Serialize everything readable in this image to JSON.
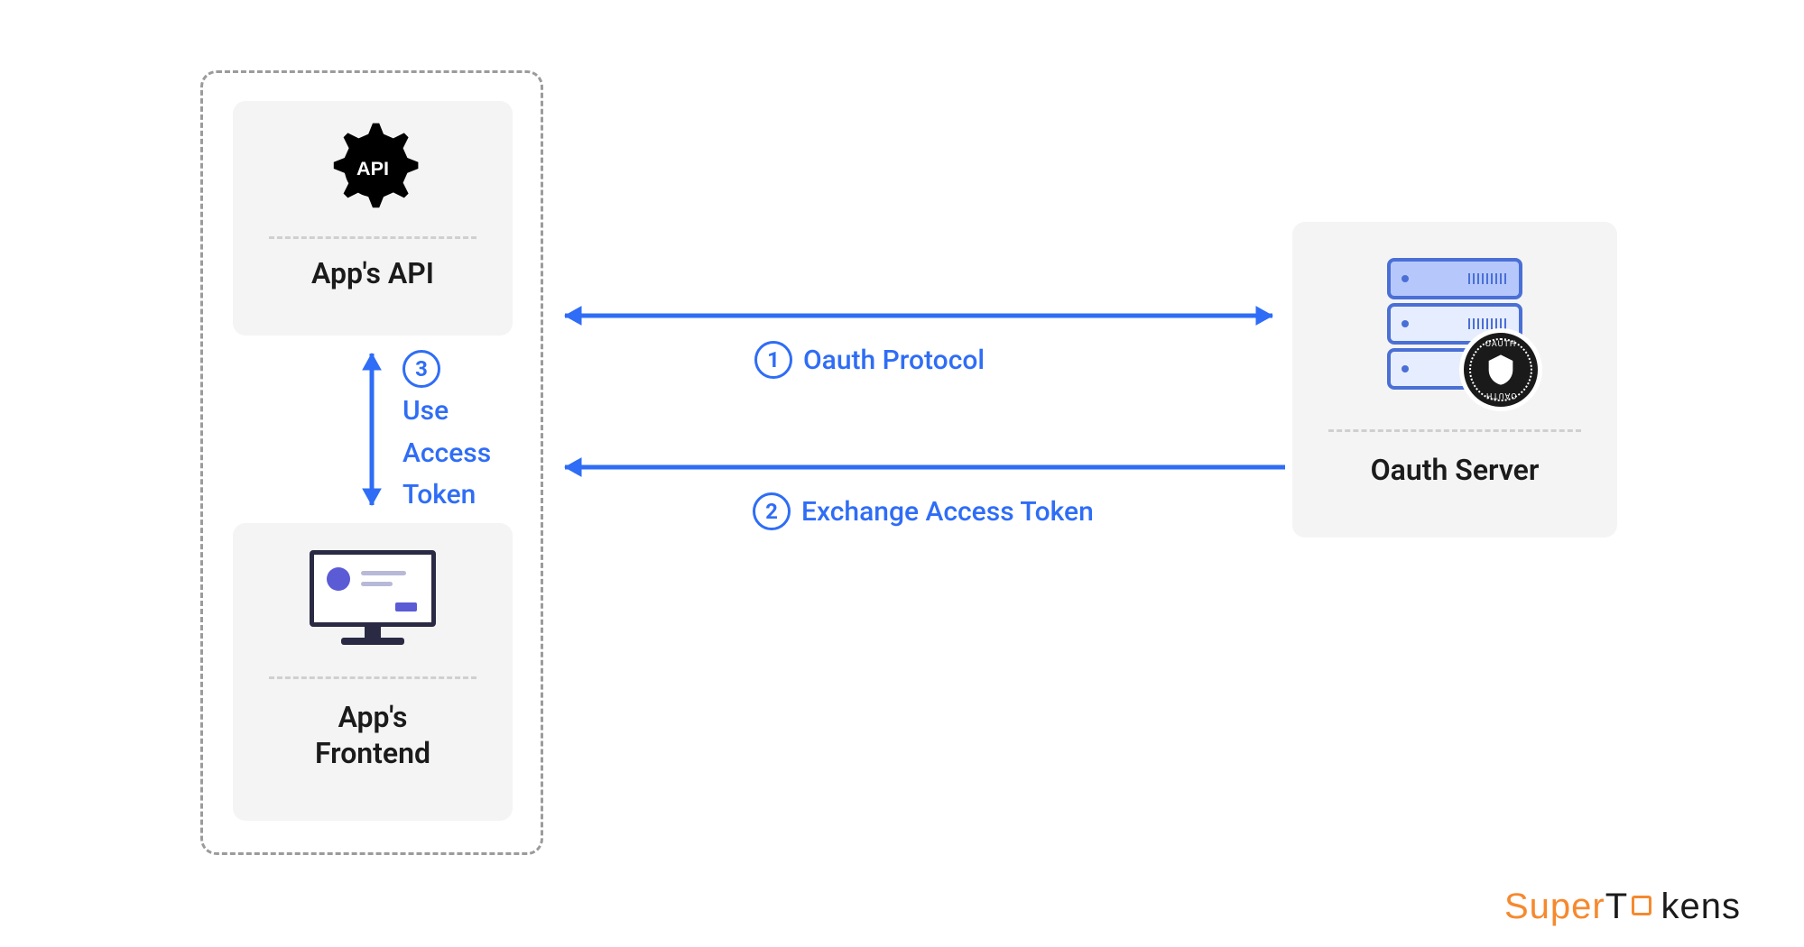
{
  "colors": {
    "accent": "#2f6df6",
    "node_bg": "#f4f4f4",
    "dashed": "#9b9b9b",
    "server_outline": "#4a6fd6",
    "brand_orange": "#f6892e"
  },
  "app_group": {
    "api": {
      "label": "App's API"
    },
    "frontend": {
      "label_line1": "App's",
      "label_line2": "Frontend"
    }
  },
  "oauth_server": {
    "label": "Oauth Server",
    "badge_text": "OAUTH"
  },
  "flows": {
    "step1": {
      "num": "1",
      "text": "Oauth Protocol"
    },
    "step2": {
      "num": "2",
      "text": "Exchange Access Token"
    },
    "step3": {
      "num": "3",
      "text_line1": "Use",
      "text_line2": "Access",
      "text_line3": "Token"
    }
  },
  "watermark": {
    "part1": "Super",
    "part2": "Tokens"
  }
}
